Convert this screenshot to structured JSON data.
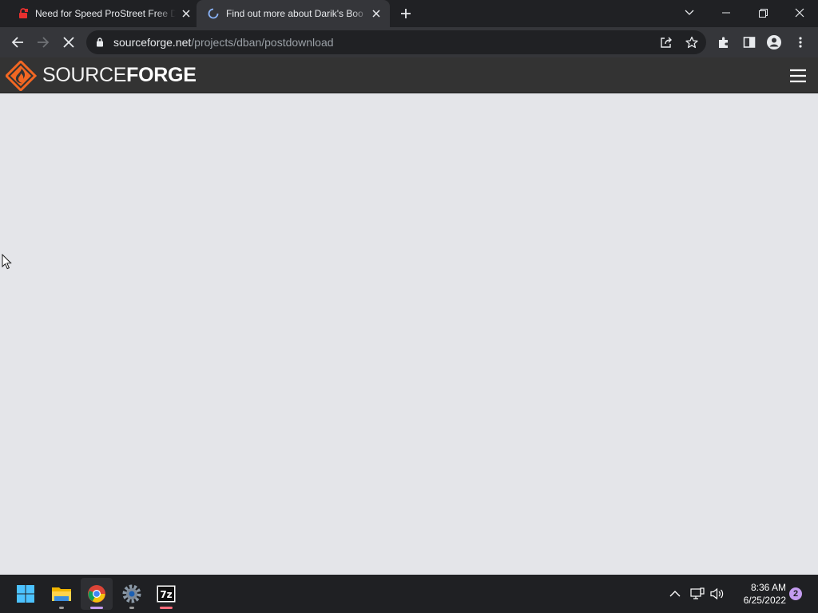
{
  "browser": {
    "tabs": [
      {
        "title": "Need for Speed ProStreet Free D",
        "favicon": "red-lock-icon",
        "active": false
      },
      {
        "title": "Find out more about Darik's Boo",
        "favicon": "loading-spinner-icon",
        "active": true
      }
    ],
    "url": {
      "host": "sourceforge.net",
      "path": "/projects/dban/postdownload"
    }
  },
  "site": {
    "logo_light": "SOURCE",
    "logo_bold": "FORGE",
    "accent": "#f26722",
    "header_bg": "#333333",
    "page_bg": "#e4e5e9"
  },
  "taskbar": {
    "apps": [
      "start-icon",
      "file-explorer-icon",
      "chrome-icon",
      "settings-icon",
      "7zip-icon"
    ],
    "sevenzip_label": "7z",
    "time": "8:36 AM",
    "date": "6/25/2022",
    "notification_count": "2"
  }
}
